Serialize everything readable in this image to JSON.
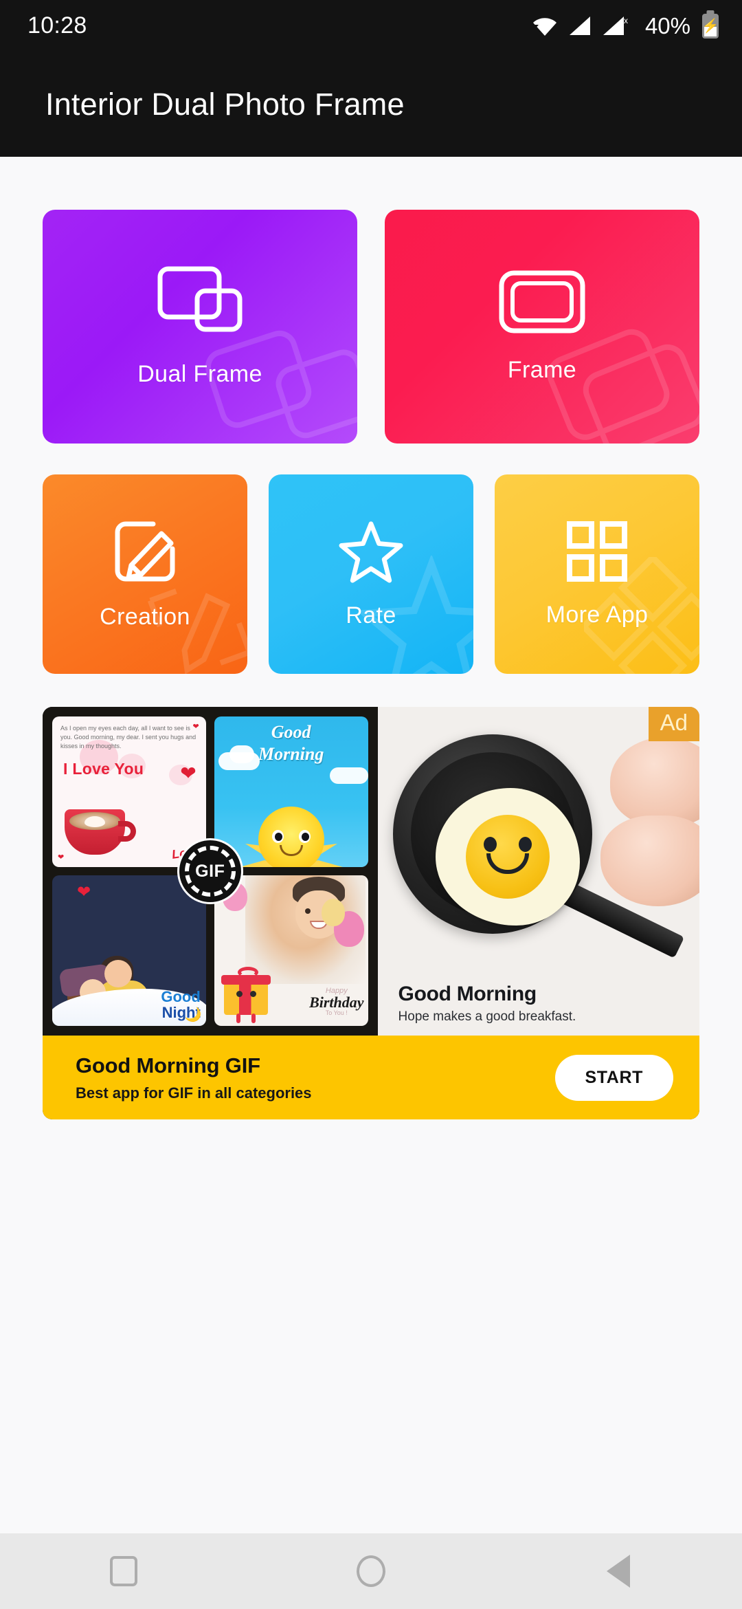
{
  "status_bar": {
    "time": "10:28",
    "battery_percent": "40%",
    "icons": [
      "wifi-icon",
      "signal-icon",
      "signal-no-sim-icon",
      "battery-charging-icon"
    ]
  },
  "app_bar": {
    "title": "Interior Dual Photo Frame"
  },
  "tiles_row_1": [
    {
      "label": "Dual Frame",
      "icon": "dual-frame-icon",
      "color": "#A324F5"
    },
    {
      "label": "Frame",
      "icon": "frame-icon",
      "color": "#FA1B4B"
    }
  ],
  "tiles_row_2": [
    {
      "label": "Creation",
      "icon": "edit-pencil-icon",
      "color": "#FB8A2A"
    },
    {
      "label": "Rate",
      "icon": "star-icon",
      "color": "#2FC3F7"
    },
    {
      "label": "More App",
      "icon": "grid-apps-icon",
      "color": "#FDCE45"
    }
  ],
  "ad": {
    "badge_label": "Ad",
    "badge_color": "#E9A12B",
    "gif_badge_label": "GIF",
    "collage": [
      {
        "name": "i-love-you-card",
        "heading": "I Love You",
        "body": "As I open my eyes each day, all I want to see is you. Good morning, my dear. I sent you hugs and kisses in my thoughts.",
        "accent": "Love"
      },
      {
        "name": "good-morning-card",
        "line1": "Good",
        "line2": "Morning"
      },
      {
        "name": "good-night-card",
        "line1": "Good",
        "line2": "Night"
      },
      {
        "name": "birthday-card",
        "line1": "Happy",
        "line2": "Birthday",
        "line3": "To You !"
      }
    ],
    "promo_image": {
      "heading": "Good Morning",
      "subheading": "Hope makes a good breakfast."
    },
    "cta": {
      "title": "Good Morning GIF",
      "subtitle": "Best app for GIF in all categories",
      "button_label": "START",
      "bar_color": "#FDC500"
    }
  },
  "nav_bar": {
    "buttons": [
      {
        "name": "recents-button",
        "icon": "square-icon"
      },
      {
        "name": "home-button",
        "icon": "circle-icon"
      },
      {
        "name": "back-button",
        "icon": "triangle-left-icon"
      }
    ]
  }
}
